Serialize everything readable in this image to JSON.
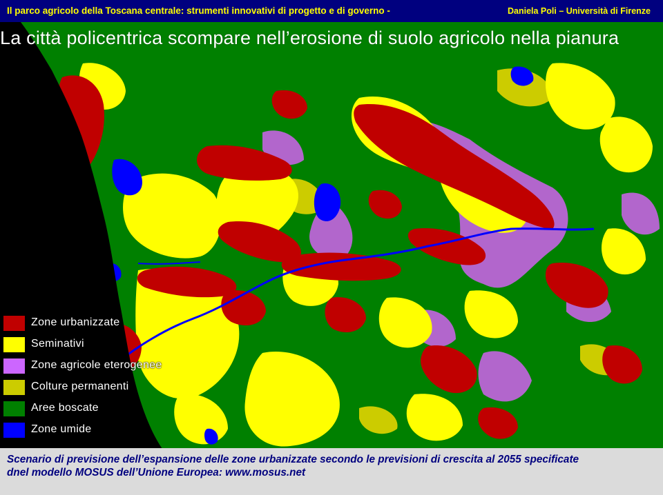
{
  "header": {
    "title": "Il parco agricolo della Toscana centrale: strumenti innovativi di progetto e di governo -",
    "author": "Daniela Poli – Università di Firenze"
  },
  "map": {
    "headline": "La città policentrica scompare nell’erosione di suolo agricolo nella pianura",
    "legend": [
      {
        "label": "Zone urbanizzate",
        "color": "#c00000"
      },
      {
        "label": "Seminativi",
        "color": "#ffff00"
      },
      {
        "label": "Zone agricole eterogenee",
        "color": "#cc66ff"
      },
      {
        "label": "Colture permanenti",
        "color": "#cccc00"
      },
      {
        "label": "Aree boscate",
        "color": "#008000"
      },
      {
        "label": "Zone umide",
        "color": "#0000ff"
      }
    ],
    "colors": {
      "background": "#000000",
      "sea": "#000000",
      "river": "#0000ff",
      "header_bg": "#00007f",
      "header_text": "#ffff00"
    }
  },
  "caption": {
    "line1": "Scenario di previsione dell’espansione delle zone urbanizzate secondo le previsioni di crescita al 2055 specificate",
    "line2": "dnel  modello MOSUS dell’Unione Europea: www.mosus.net"
  }
}
